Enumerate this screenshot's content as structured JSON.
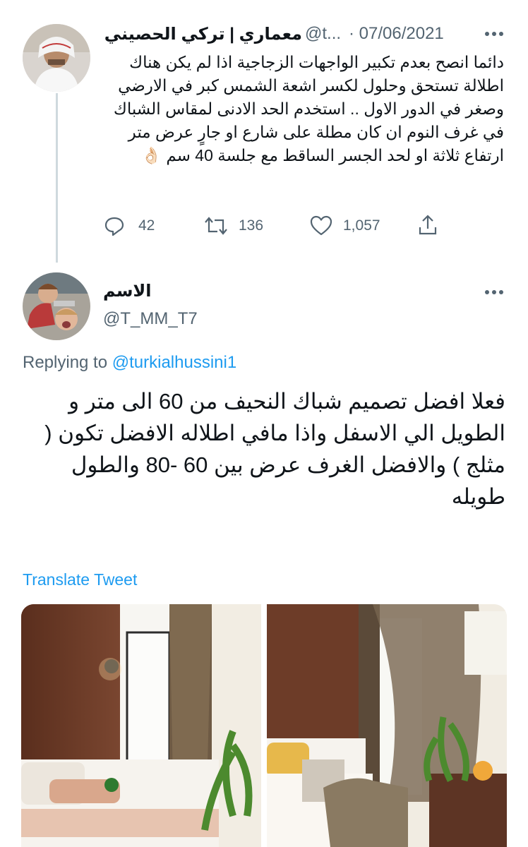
{
  "tweet1": {
    "display_name": "معماري | تركي الحصيني",
    "handle": "@t...",
    "date": "· 07/06/2021",
    "text": "دائما انصح بعدم تكبير الواجهات الزجاجية اذا لم يكن هناك اطلالة تستحق وحلول لكسر اشعة الشمس كبر في الارضي وصغر في الدور الاول .. استخدم الحد الادنى لمقاس الشباك في غرف النوم ان كان مطلة على شارع او جارٍ عرض متر ارتفاع ثلاثة او لحد الجسر الساقط مع جلسة 40 سم",
    "emoji": "👌🏻",
    "replies": "42",
    "retweets": "136",
    "likes": "1,057"
  },
  "tweet2": {
    "display_name": "الاسم",
    "handle": "@T_MM_T7",
    "replying_label": "Replying to",
    "replying_handle": "@turkialhussini1",
    "text": "فعلا افضل تصميم شباك النحيف من 60 الى متر و الطويل الي الاسفل واذا مافي اطلاله الافضل تكون ( مثلج ) والافضل الغرف عرض بين 60 -80 والطول طويله",
    "translate_label": "Translate Tweet"
  },
  "icons": {
    "more": "more-icon",
    "reply": "reply-icon",
    "retweet": "retweet-icon",
    "like": "heart-icon",
    "share": "share-icon"
  },
  "colors": {
    "link": "#1d9bf0",
    "secondary_text": "#536471",
    "thread_line": "#cfd9de"
  }
}
